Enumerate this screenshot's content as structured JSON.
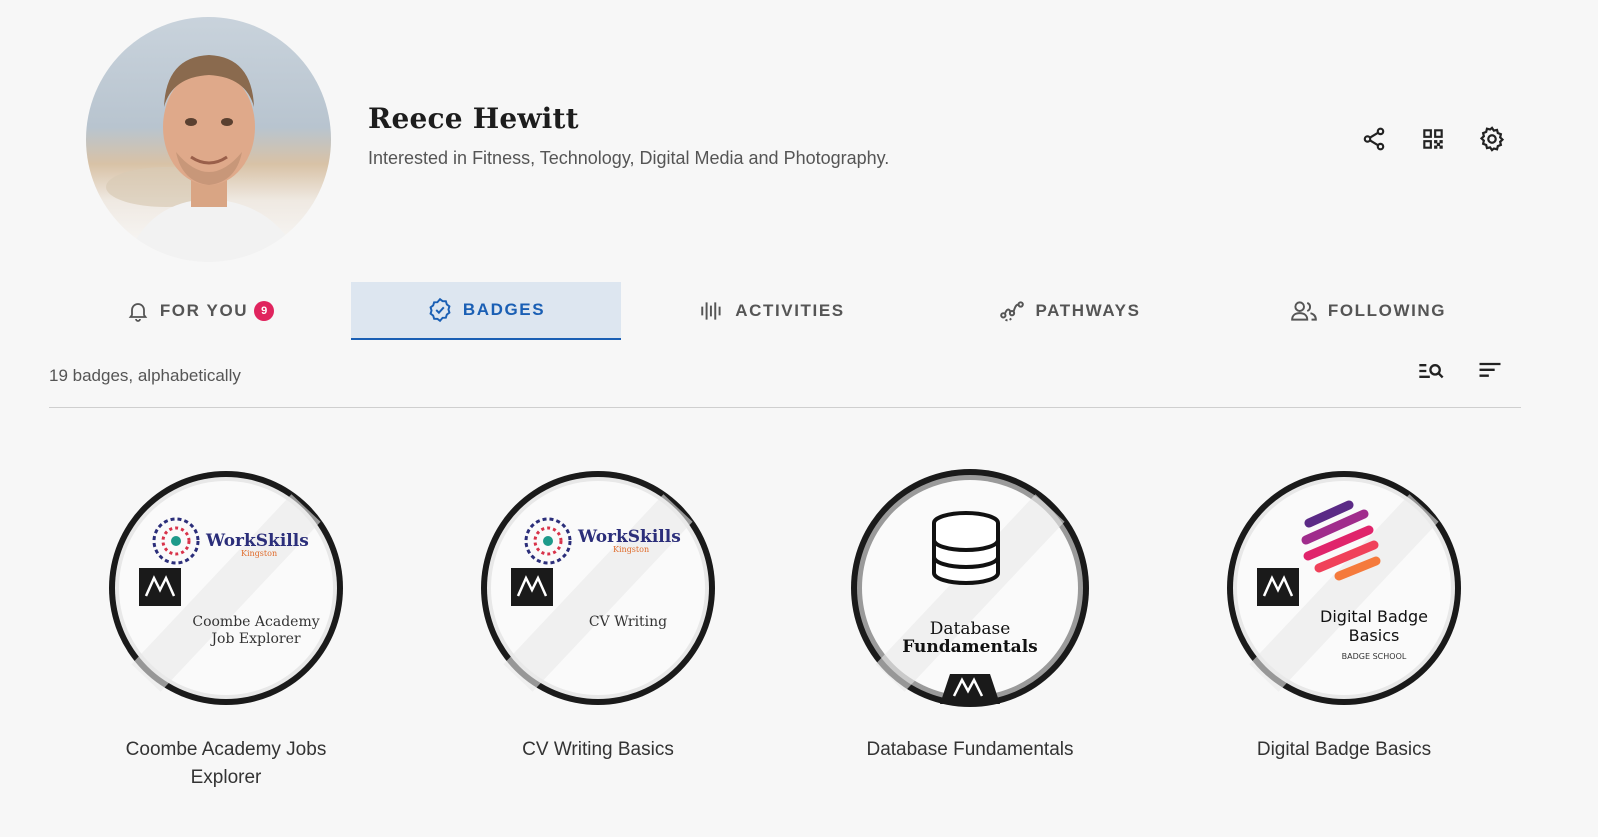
{
  "profile": {
    "name": "Reece Hewitt",
    "bio": "Interested in Fitness, Technology, Digital Media and Photography."
  },
  "header_actions": [
    {
      "icon": "share-icon"
    },
    {
      "icon": "qr-code-icon"
    },
    {
      "icon": "gear-icon"
    }
  ],
  "tabs": [
    {
      "label": "FOR YOU",
      "icon": "bell-icon",
      "count": "9",
      "active": false
    },
    {
      "label": "BADGES",
      "icon": "badge-check-icon",
      "active": true
    },
    {
      "label": "ACTIVITIES",
      "icon": "waveform-icon",
      "active": false
    },
    {
      "label": "PATHWAYS",
      "icon": "pathway-icon",
      "active": false
    },
    {
      "label": "FOLLOWING",
      "icon": "people-icon",
      "active": false
    }
  ],
  "list": {
    "summary": "19 badges, alphabetically",
    "tools": [
      {
        "icon": "filter-search-icon"
      },
      {
        "icon": "sort-icon"
      }
    ]
  },
  "badges": [
    {
      "title": "Coombe Academy Jobs Explorer",
      "logo_text": "WorkSkills",
      "logo_subtext": "Kingston",
      "inner_line1": "Coombe Academy",
      "inner_line2": "Job Explorer"
    },
    {
      "title": "CV Writing Basics",
      "logo_text": "WorkSkills",
      "logo_subtext": "Kingston",
      "inner_line1": "CV Writing"
    },
    {
      "title": "Database Fundamentals",
      "inner_line1": "Database",
      "inner_line2": "Fundamentals",
      "icon": "database-icon"
    },
    {
      "title": "Digital Badge Basics",
      "inner_line1": "Digital Badge",
      "inner_line2": "Basics",
      "inner_line3": "BADGE SCHOOL",
      "icon": "brush-strokes-icon"
    }
  ],
  "colors": {
    "accent": "#1a5fb4",
    "active_tab_bg": "#dde6f0",
    "notification": "#e0245e",
    "background": "#f7f7f7"
  }
}
